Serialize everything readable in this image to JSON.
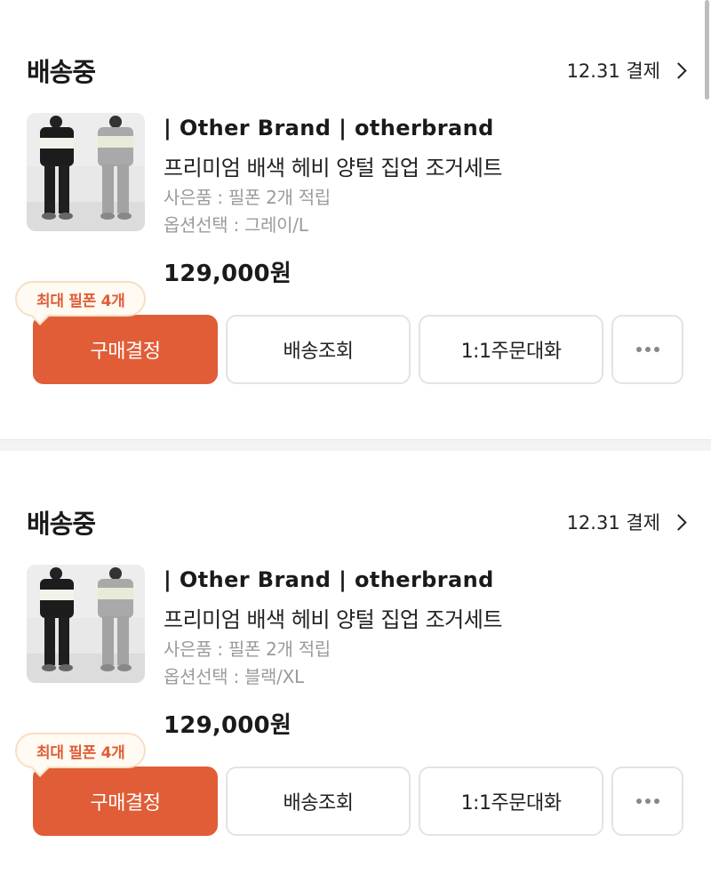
{
  "orders": [
    {
      "status": "배송중",
      "date": "12.31 결제",
      "brand": "| Other Brand | otherbrand",
      "product_name": "프리미엄 배색 헤비 양털 집업 조거세트",
      "gift": "사은품 : 필폰 2개 적립",
      "option": "옵션선택 : 그레이/L",
      "price": "129,000원",
      "tooltip": "최대 필폰 4개",
      "buttons": {
        "confirm": "구매결정",
        "track": "배송조회",
        "chat": "1:1주문대화"
      }
    },
    {
      "status": "배송중",
      "date": "12.31 결제",
      "brand": "| Other Brand | otherbrand",
      "product_name": "프리미엄 배색 헤비 양털 집업 조거세트",
      "gift": "사은품 : 필폰 2개 적립",
      "option": "옵션선택 : 블랙/XL",
      "price": "129,000원",
      "tooltip": "최대 필폰 4개",
      "buttons": {
        "confirm": "구매결정",
        "track": "배송조회",
        "chat": "1:1주문대화"
      }
    }
  ],
  "icons": {
    "chevron": "chevron-right-icon",
    "more": "more-horizontal-icon"
  },
  "colors": {
    "accent": "#e05d37",
    "muted_text": "#9b9b9b",
    "button_border": "#e3e3e3",
    "tooltip_bg": "#fffaf2"
  }
}
